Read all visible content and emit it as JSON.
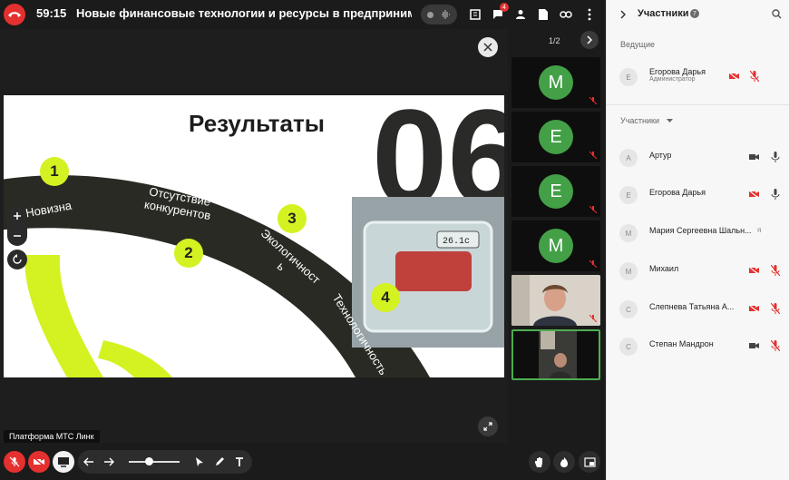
{
  "topbar": {
    "timer": "59:15",
    "title": "Новые финансовые технологии и ресурсы в предпринимательст",
    "chat_badge": "4"
  },
  "stage": {
    "platform_label": "Платформа МТС Линк",
    "slide": {
      "heading": "Результаты",
      "big_number": "06",
      "items": [
        {
          "num": "1",
          "label": "Новизна"
        },
        {
          "num": "2",
          "label_line1": "Отсутствие",
          "label_line2": "конкурентов"
        },
        {
          "num": "3",
          "label_line1": "Экологичност",
          "label_line2": "ь"
        },
        {
          "num": "4",
          "label": "Технологичность"
        }
      ],
      "scale_reading": "26.1c"
    },
    "colors": {
      "accent_green": "#d4f221",
      "dark_band": "#2a2a24"
    }
  },
  "thumbnails": {
    "page_indicator": "1/2",
    "tiles": [
      {
        "letter": "М"
      },
      {
        "letter": "Е"
      },
      {
        "letter": "Е"
      },
      {
        "letter": "М"
      }
    ]
  },
  "panel": {
    "title": "Участники",
    "count": "7",
    "hosts_label": "Ведущие",
    "participants_label": "Участники",
    "host": {
      "initial": "Е",
      "name": "Егорова Дарья",
      "role": "Администратор"
    },
    "participants": [
      {
        "initial": "А",
        "name": "Артур"
      },
      {
        "initial": "Е",
        "name": "Егорова Дарья"
      },
      {
        "initial": "М",
        "name": "Мария Сергеевна Шальн...",
        "suffix": "я"
      },
      {
        "initial": "М",
        "name": "Михаил"
      },
      {
        "initial": "С",
        "name": "Слепнева Татьяна А..."
      },
      {
        "initial": "С",
        "name": "Степан Мандрон"
      }
    ]
  }
}
